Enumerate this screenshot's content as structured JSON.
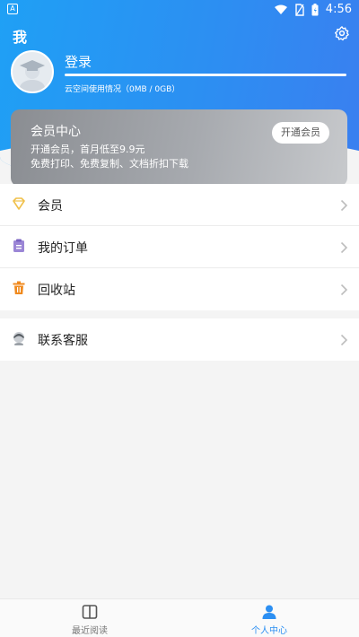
{
  "status_bar": {
    "time": "4:56",
    "left_badge": "A"
  },
  "header": {
    "title": "我"
  },
  "profile": {
    "login_label": "登录",
    "storage_text": "云空间使用情况（0MB / 0GB）",
    "storage_used_fraction": 0
  },
  "vip": {
    "title": "会员中心",
    "line1": "开通会员，首月低至9.9元",
    "line2": "免费打印、免费复制、文档折扣下载",
    "button_label": "开通会员"
  },
  "menu_group1": [
    {
      "label": "会员",
      "icon": "diamond-icon"
    },
    {
      "label": "我的订单",
      "icon": "clipboard-icon"
    },
    {
      "label": "回收站",
      "icon": "trash-icon"
    }
  ],
  "menu_group2": [
    {
      "label": "联系客服",
      "icon": "customer-service-icon"
    }
  ],
  "tabs": [
    {
      "label": "最近阅读",
      "icon": "book-icon",
      "active": false
    },
    {
      "label": "个人中心",
      "icon": "person-icon",
      "active": true
    }
  ],
  "colors": {
    "accent": "#2c8ff2",
    "vip_gray": "#a7aaaf",
    "diamond": "#f0c04a",
    "clipboard": "#9b86d6",
    "trash": "#f08a1e"
  }
}
